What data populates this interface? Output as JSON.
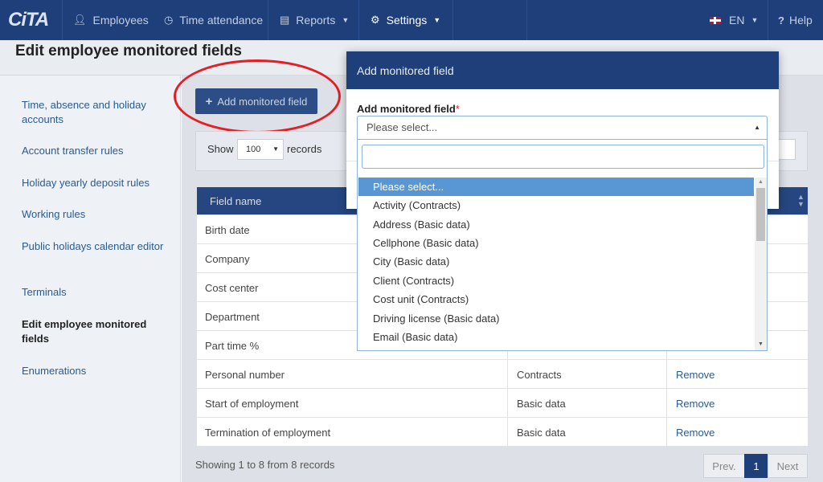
{
  "nav": {
    "logo": "CiTA",
    "items": [
      {
        "label": "Employees",
        "icon": "user-icon"
      },
      {
        "label": "Time attendance",
        "icon": "clock-icon"
      },
      {
        "label": "Reports",
        "icon": "print-icon"
      },
      {
        "label": "Settings",
        "icon": "gear-icon"
      }
    ],
    "language": "EN",
    "help": "Help"
  },
  "page": {
    "title": "Edit employee monitored fields"
  },
  "sidebar": {
    "items": [
      {
        "label": "Time, absence and holiday accounts"
      },
      {
        "label": "Account transfer rules"
      },
      {
        "label": "Holiday yearly deposit rules"
      },
      {
        "label": "Working rules"
      },
      {
        "label": "Public holidays calendar editor"
      },
      {
        "label": "Terminals"
      },
      {
        "label": "Edit employee monitored fields"
      },
      {
        "label": "Enumerations"
      }
    ]
  },
  "toolbar": {
    "add_label": "Add monitored field"
  },
  "filter": {
    "show_label": "Show",
    "show_value": "100",
    "records_label": "records"
  },
  "table": {
    "header": "Field name",
    "rows": [
      {
        "name": "Birth date",
        "group": "",
        "action": ""
      },
      {
        "name": "Company",
        "group": "",
        "action": ""
      },
      {
        "name": "Cost center",
        "group": "",
        "action": ""
      },
      {
        "name": "Department",
        "group": "",
        "action": ""
      },
      {
        "name": "Part time %",
        "group": "",
        "action": ""
      },
      {
        "name": "Personal number",
        "group": "Contracts",
        "action": "Remove"
      },
      {
        "name": "Start of employment",
        "group": "Basic data",
        "action": "Remove"
      },
      {
        "name": "Termination of employment",
        "group": "Basic data",
        "action": "Remove"
      }
    ]
  },
  "footer": {
    "info": "Showing 1 to 8 from 8 records",
    "prev": "Prev.",
    "page": "1",
    "next": "Next"
  },
  "modal": {
    "title": "Add monitored field",
    "field_label": "Add monitored field",
    "required_mark": "*",
    "select_value": "Please select...",
    "options": [
      "Please select...",
      "Activity (Contracts)",
      "Address (Basic data)",
      "Cellphone (Basic data)",
      "City (Basic data)",
      "Client (Contracts)",
      "Cost unit (Contracts)",
      "Driving license (Basic data)",
      "Email (Basic data)"
    ],
    "selected_index": 0
  },
  "colors": {
    "navbar": "#1f3f7a",
    "highlight": "#5897d4",
    "annotation": "#e31e24"
  }
}
